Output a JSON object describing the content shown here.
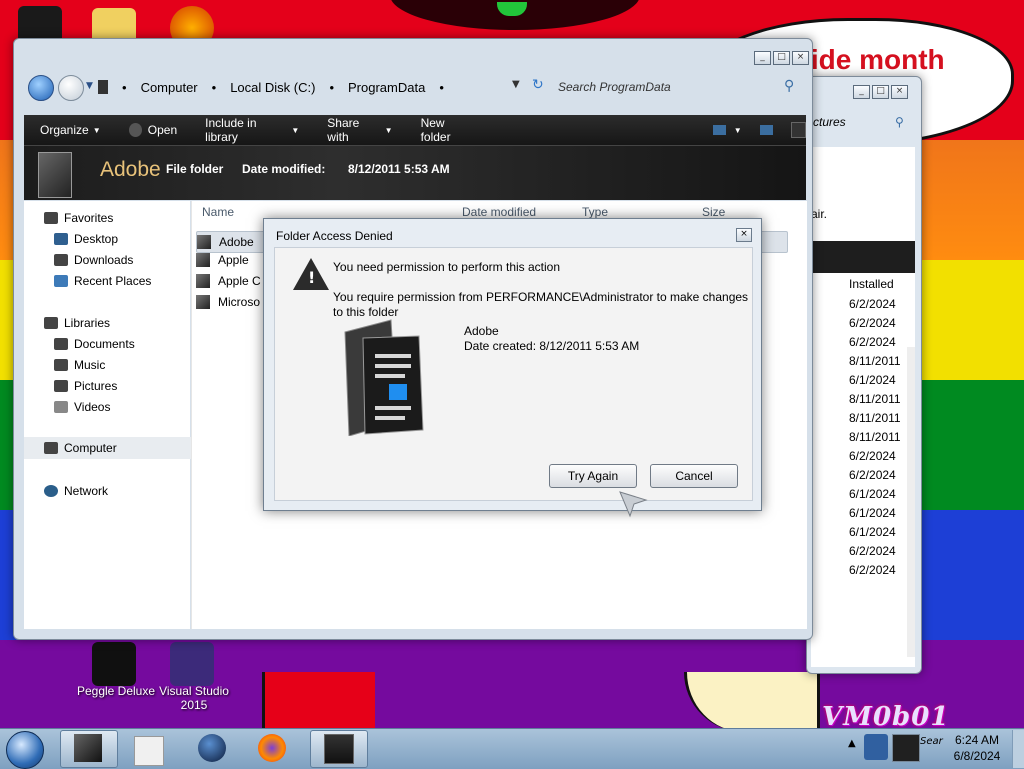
{
  "desktop": {
    "speech_text": "ride month",
    "icons": [
      {
        "label_line1": "Peggle Deluxe",
        "label_line2": ""
      },
      {
        "label_line1": "Visual Studio",
        "label_line2": "2015"
      }
    ],
    "signature": "VM0b01"
  },
  "back_window": {
    "search_text": "ctures",
    "partial_text": "air.",
    "col_installed": "Installed",
    "dates": [
      "6/2/2024",
      "6/2/2024",
      "6/2/2024",
      "8/11/2011",
      "6/1/2024",
      "8/11/2011",
      "8/11/2011",
      "8/11/2011",
      "6/2/2024",
      "6/2/2024",
      "6/1/2024",
      "6/1/2024",
      "6/1/2024",
      "6/2/2024",
      "6/2/2024"
    ]
  },
  "explorer": {
    "breadcrumbs": [
      "Computer",
      "Local Disk (C:)",
      "ProgramData"
    ],
    "search_placeholder": "Search ProgramData",
    "toolbar": {
      "organize": "Organize",
      "open": "Open",
      "include_in_library": "Include in library",
      "share_with": "Share with",
      "new_folder": "New folder"
    },
    "details": {
      "name": "Adobe",
      "type": "File folder",
      "date_label": "Date modified:",
      "date_value": "8/12/2011 5:53 AM"
    },
    "nav": {
      "favorites": "Favorites",
      "desktop": "Desktop",
      "downloads": "Downloads",
      "recent_places": "Recent Places",
      "libraries": "Libraries",
      "documents": "Documents",
      "music": "Music",
      "pictures": "Pictures",
      "videos": "Videos",
      "computer": "Computer",
      "network": "Network"
    },
    "columns": {
      "name": "Name",
      "date_modified": "Date modified",
      "type": "Type",
      "size": "Size"
    },
    "files": [
      "Adobe",
      "Apple",
      "Apple C",
      "Microso"
    ]
  },
  "dialog": {
    "title": "Folder Access Denied",
    "message_heading": "You need permission to perform this action",
    "message_detail": "You require permission from PERFORMANCE\\Administrator to make changes to this folder",
    "folder_name": "Adobe",
    "date_created": "Date created: 8/12/2011 5:53 AM",
    "try_again": "Try Again",
    "cancel": "Cancel"
  },
  "taskbar": {
    "time": "6:24 AM",
    "date": "6/8/2024",
    "tray_text": "Sear"
  },
  "colors": {
    "speech_text": "#d5101f",
    "details_name": "#e8c27a",
    "toolbar_bg": "#1c1c1c",
    "taskbar": "#9db8d2"
  }
}
